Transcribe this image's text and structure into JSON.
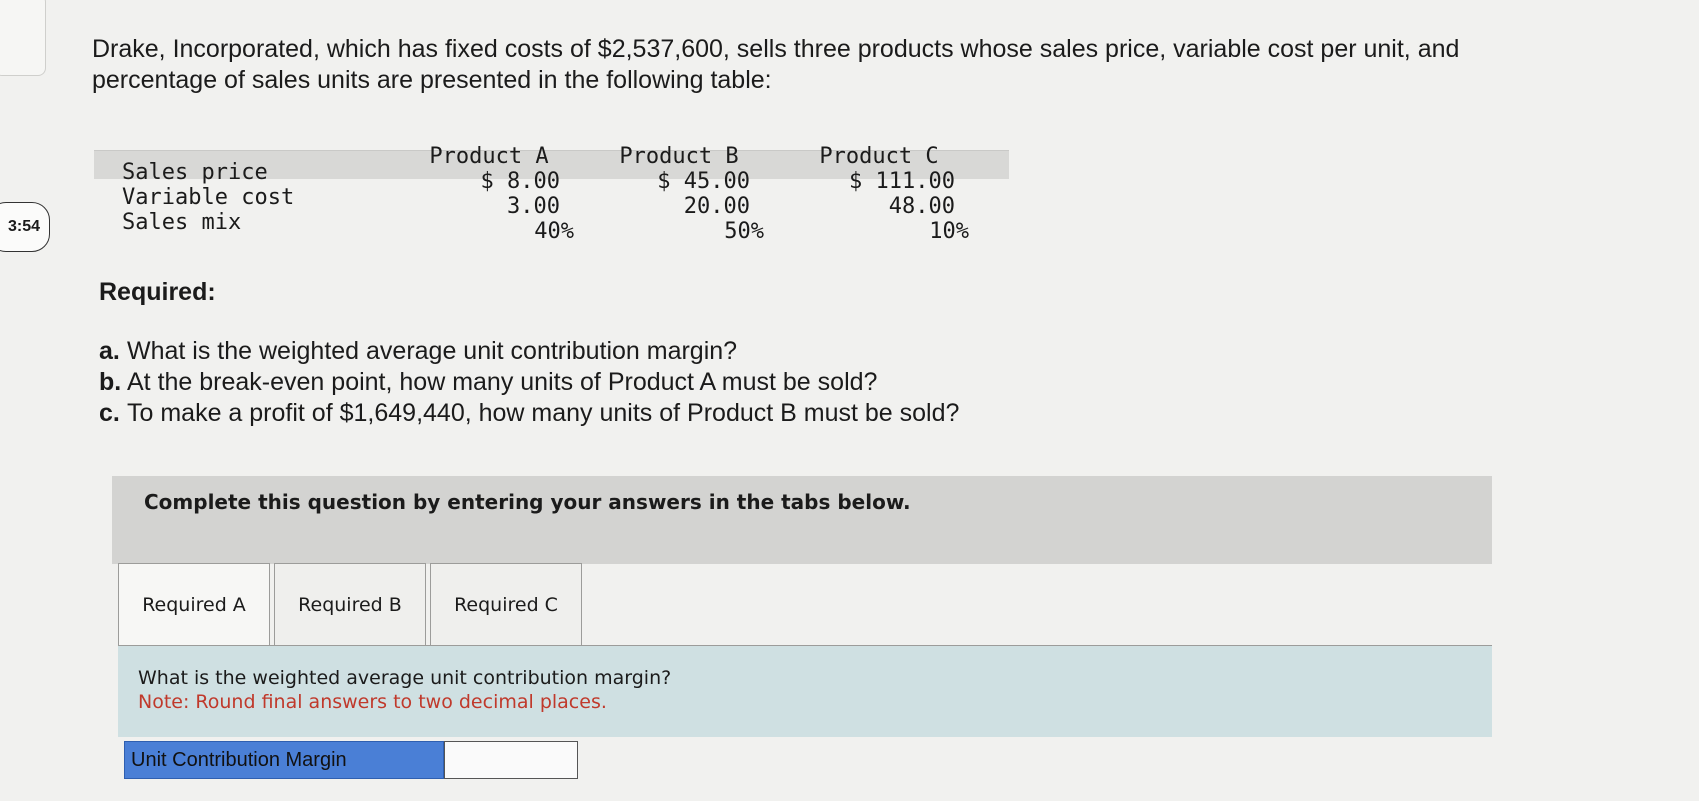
{
  "timer": "3:54",
  "problem": {
    "text": "Drake, Incorporated, which has fixed costs of $2,537,600, sells three products whose sales price, variable cost per unit, and percentage of sales units are presented in the following table:"
  },
  "table": {
    "row_labels": [
      "Sales price",
      "Variable cost",
      "Sales mix"
    ],
    "columns": [
      {
        "header": "Product A",
        "price": "$ 8.00",
        "variable": "3.00",
        "mix": "40%"
      },
      {
        "header": "Product B",
        "price": "$ 45.00",
        "variable": "20.00",
        "mix": "50%"
      },
      {
        "header": "Product C",
        "price": "$ 111.00",
        "variable": "48.00",
        "mix": "10%"
      }
    ]
  },
  "required": {
    "title": "Required:",
    "items": [
      {
        "letter": "a.",
        "text": "What is the weighted average unit contribution margin?"
      },
      {
        "letter": "b.",
        "text": "At the break-even point, how many units of Product A must be sold?"
      },
      {
        "letter": "c.",
        "text": "To make a profit of $1,649,440, how many units of Product B must be sold?"
      }
    ]
  },
  "banner": "Complete this question by entering your answers in the tabs below.",
  "tabs": [
    "Required A",
    "Required B",
    "Required C"
  ],
  "panel": {
    "question": "What is the weighted average unit contribution margin?",
    "note": "Note: Round final answers to two decimal places."
  },
  "answer": {
    "label": "Unit Contribution Margin",
    "value": ""
  }
}
